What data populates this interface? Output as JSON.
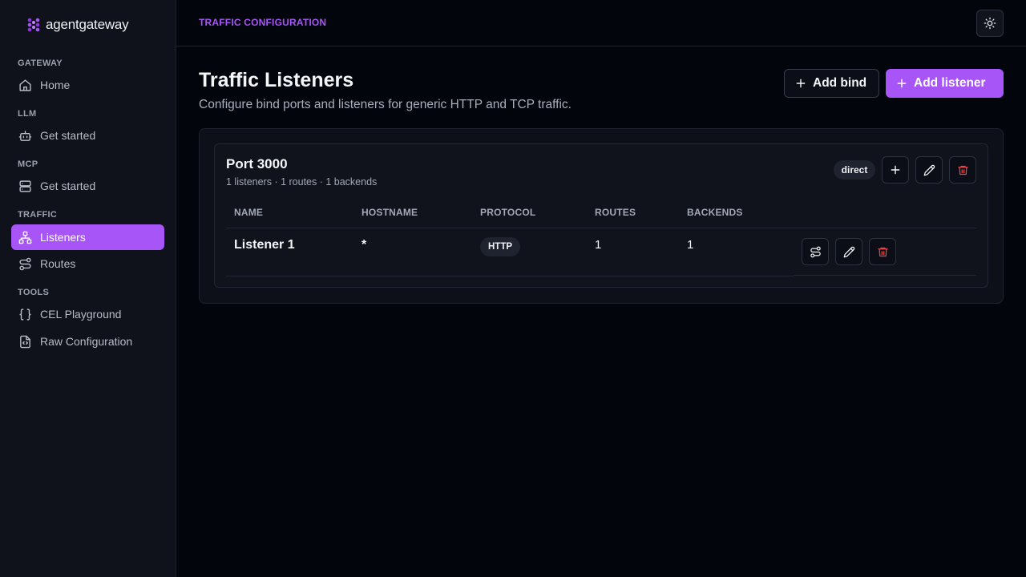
{
  "app": {
    "logo_text": "agentgateway"
  },
  "sidebar": {
    "sections": [
      {
        "label": "GATEWAY",
        "items": [
          {
            "label": "Home",
            "icon": "home-icon"
          }
        ]
      },
      {
        "label": "LLM",
        "items": [
          {
            "label": "Get started",
            "icon": "bot-icon"
          }
        ]
      },
      {
        "label": "MCP",
        "items": [
          {
            "label": "Get started",
            "icon": "server-icon"
          }
        ]
      },
      {
        "label": "TRAFFIC",
        "items": [
          {
            "label": "Listeners",
            "icon": "network-icon",
            "active": true
          },
          {
            "label": "Routes",
            "icon": "route-icon"
          }
        ]
      },
      {
        "label": "TOOLS",
        "items": [
          {
            "label": "CEL Playground",
            "icon": "braces-icon"
          },
          {
            "label": "Raw Configuration",
            "icon": "file-code-icon"
          }
        ]
      }
    ]
  },
  "header": {
    "breadcrumb": "TRAFFIC CONFIGURATION",
    "theme_icon": "sun-icon"
  },
  "main": {
    "title": "Traffic Listeners",
    "subtitle": "Configure bind ports and listeners for generic HTTP and TCP traffic.",
    "add_bind_label": "Add bind",
    "add_listener_label": "Add listener"
  },
  "bind": {
    "title": "Port 3000",
    "meta": "1 listeners · 1 routes · 1 backends",
    "mode_badge": "direct"
  },
  "table": {
    "columns": [
      "NAME",
      "HOSTNAME",
      "PROTOCOL",
      "ROUTES",
      "BACKENDS"
    ],
    "rows": [
      {
        "name": "Listener 1",
        "hostname": "*",
        "protocol": "HTTP",
        "routes": "1",
        "backends": "1"
      }
    ]
  },
  "colors": {
    "accent": "#a855f7",
    "danger": "#ef4444",
    "background": "#03050d",
    "sidebar": "#0f121b"
  }
}
